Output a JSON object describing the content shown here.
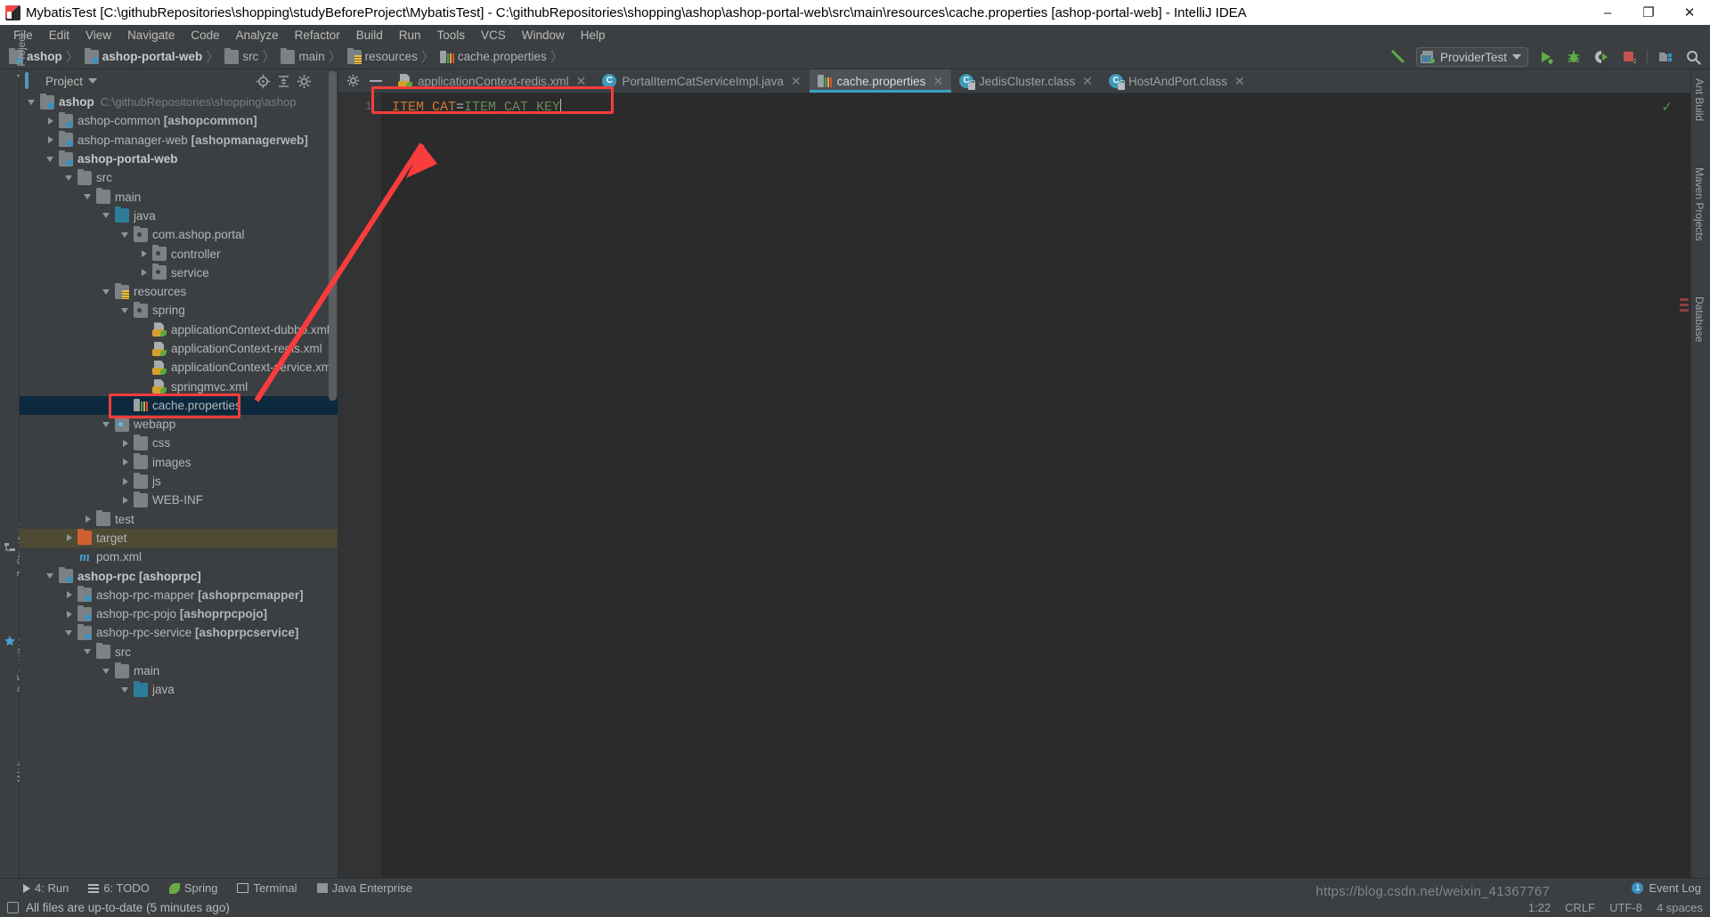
{
  "window": {
    "title": "MybatisTest [C:\\githubRepositories\\shopping\\studyBeforeProject\\MybatisTest] - C:\\githubRepositories\\shopping\\ashop\\ashop-portal-web\\src\\main\\resources\\cache.properties [ashop-portal-web] - IntelliJ IDEA",
    "minimize": "–",
    "maximize": "❐",
    "close": "✕"
  },
  "menubar": {
    "items": [
      {
        "label": "File"
      },
      {
        "label": "Edit"
      },
      {
        "label": "View"
      },
      {
        "label": "Navigate"
      },
      {
        "label": "Code"
      },
      {
        "label": "Analyze"
      },
      {
        "label": "Refactor"
      },
      {
        "label": "Build"
      },
      {
        "label": "Run"
      },
      {
        "label": "Tools"
      },
      {
        "label": "VCS"
      },
      {
        "label": "Window"
      },
      {
        "label": "Help"
      }
    ]
  },
  "navbar": {
    "crumbs": [
      {
        "label": "ashop",
        "icon": "module-icon",
        "bold": true
      },
      {
        "label": "ashop-portal-web",
        "icon": "module-icon",
        "bold": true
      },
      {
        "label": "src",
        "icon": "folder-icon",
        "bold": false
      },
      {
        "label": "main",
        "icon": "folder-icon",
        "bold": false
      },
      {
        "label": "resources",
        "icon": "resources-folder-icon",
        "bold": false
      },
      {
        "label": "cache.properties",
        "icon": "properties-file-icon",
        "bold": false
      }
    ],
    "separator": "〉",
    "run_config": "ProviderTest",
    "buttons": [
      {
        "name": "build-hammer-icon",
        "label": "Build"
      },
      {
        "name": "run-button",
        "label": "Run"
      },
      {
        "name": "debug-button",
        "label": "Debug"
      },
      {
        "name": "run-coverage-button",
        "label": "Run with Coverage"
      },
      {
        "name": "stop-button",
        "label": "Stop"
      },
      {
        "name": "project-structure-button",
        "label": "Project Structure"
      },
      {
        "name": "search-everywhere-button",
        "label": "Search Everywhere"
      }
    ]
  },
  "project_panel": {
    "title": "Project",
    "header_actions": [
      "locate-icon",
      "collapse-all-icon",
      "settings-gear-icon",
      "hide-icon"
    ],
    "tree": [
      {
        "depth": 0,
        "arrow": "down",
        "icon": "module-icon",
        "label": "ashop",
        "bold": true,
        "path": "C:\\githubRepositories\\shopping\\ashop"
      },
      {
        "depth": 1,
        "arrow": "right",
        "icon": "module-icon",
        "label": "ashop-common ",
        "module": "[ashopcommon]"
      },
      {
        "depth": 1,
        "arrow": "right",
        "icon": "module-icon",
        "label": "ashop-manager-web ",
        "module": "[ashopmanagerweb]"
      },
      {
        "depth": 1,
        "arrow": "down",
        "icon": "module-icon",
        "label": "ashop-portal-web",
        "bold": true
      },
      {
        "depth": 2,
        "arrow": "down",
        "icon": "folder-icon",
        "label": "src"
      },
      {
        "depth": 3,
        "arrow": "down",
        "icon": "folder-icon",
        "label": "main"
      },
      {
        "depth": 4,
        "arrow": "down",
        "icon": "source-root-icon",
        "label": "java"
      },
      {
        "depth": 5,
        "arrow": "down",
        "icon": "package-icon",
        "label": "com.ashop.portal"
      },
      {
        "depth": 6,
        "arrow": "right",
        "icon": "package-icon",
        "label": "controller"
      },
      {
        "depth": 6,
        "arrow": "right",
        "icon": "package-icon",
        "label": "service"
      },
      {
        "depth": 4,
        "arrow": "down",
        "icon": "resources-folder-icon",
        "label": "resources"
      },
      {
        "depth": 5,
        "arrow": "down",
        "icon": "package-icon",
        "label": "spring"
      },
      {
        "depth": 6,
        "arrow": "none",
        "icon": "spring-xml-icon",
        "label": "applicationContext-dubbo.xml"
      },
      {
        "depth": 6,
        "arrow": "none",
        "icon": "spring-xml-icon",
        "label": "applicationContext-redis.xml"
      },
      {
        "depth": 6,
        "arrow": "none",
        "icon": "spring-xml-icon",
        "label": "applicationContext-service.xml"
      },
      {
        "depth": 6,
        "arrow": "none",
        "icon": "spring-xml-icon",
        "label": "springmvc.xml"
      },
      {
        "depth": 5,
        "arrow": "none",
        "icon": "properties-file-icon",
        "label": "cache.properties",
        "selected": true
      },
      {
        "depth": 4,
        "arrow": "down",
        "icon": "webapp-folder-icon",
        "label": "webapp"
      },
      {
        "depth": 5,
        "arrow": "right",
        "icon": "folder-icon",
        "label": "css"
      },
      {
        "depth": 5,
        "arrow": "right",
        "icon": "folder-icon",
        "label": "images"
      },
      {
        "depth": 5,
        "arrow": "right",
        "icon": "folder-icon",
        "label": "js"
      },
      {
        "depth": 5,
        "arrow": "right",
        "icon": "folder-icon",
        "label": "WEB-INF"
      },
      {
        "depth": 3,
        "arrow": "right",
        "icon": "folder-icon",
        "label": "test"
      },
      {
        "depth": 2,
        "arrow": "right",
        "icon": "excluded-folder-icon",
        "label": "target",
        "excluded": true
      },
      {
        "depth": 2,
        "arrow": "none",
        "icon": "maven-icon",
        "label": "pom.xml"
      },
      {
        "depth": 1,
        "arrow": "down",
        "icon": "module-icon",
        "label": "ashop-rpc ",
        "module": "[ashoprpc]",
        "bold": true
      },
      {
        "depth": 2,
        "arrow": "right",
        "icon": "module-icon",
        "label": "ashop-rpc-mapper ",
        "module": "[ashoprpcmapper]"
      },
      {
        "depth": 2,
        "arrow": "right",
        "icon": "module-icon",
        "label": "ashop-rpc-pojo ",
        "module": "[ashoprpcpojo]"
      },
      {
        "depth": 2,
        "arrow": "down",
        "icon": "module-icon",
        "label": "ashop-rpc-service ",
        "module": "[ashoprpcservice]"
      },
      {
        "depth": 3,
        "arrow": "down",
        "icon": "folder-icon",
        "label": "src"
      },
      {
        "depth": 4,
        "arrow": "down",
        "icon": "folder-icon",
        "label": "main"
      },
      {
        "depth": 5,
        "arrow": "down",
        "icon": "source-root-icon",
        "label": "java"
      }
    ]
  },
  "editor": {
    "tabs": [
      {
        "label": "applicationContext-redis.xml",
        "icon": "spring-xml-icon",
        "active": false,
        "close": "✕"
      },
      {
        "label": "PortalItemCatServiceImpl.java",
        "icon": "class-icon",
        "active": false,
        "close": "✕"
      },
      {
        "label": "cache.properties",
        "icon": "properties-file-icon",
        "active": true,
        "close": "✕"
      },
      {
        "label": "JedisCluster.class",
        "icon": "class-locked-icon",
        "active": false,
        "close": "✕"
      },
      {
        "label": "HostAndPort.class",
        "icon": "class-locked-icon",
        "active": false,
        "close": "✕"
      }
    ],
    "line_numbers": [
      "1"
    ],
    "code": {
      "key": "ITEM_CAT",
      "equals": "=",
      "value": "ITEM_CAT_KEY"
    },
    "inspection_ok": "✓"
  },
  "left_rail": {
    "items": [
      {
        "label": "1: Project"
      },
      {
        "label": "7: Structure"
      },
      {
        "label": "2: Favorites"
      },
      {
        "label": "Web"
      }
    ]
  },
  "right_rail": {
    "items": [
      {
        "label": "Ant Build"
      },
      {
        "label": "Maven Projects"
      },
      {
        "label": "Database"
      }
    ]
  },
  "bottom_bar": {
    "items": [
      {
        "label": "4: Run",
        "icon": "run-icon"
      },
      {
        "label": "6: TODO",
        "icon": "todo-icon"
      },
      {
        "label": "Spring",
        "icon": "spring-icon"
      },
      {
        "label": "Terminal",
        "icon": "terminal-icon"
      },
      {
        "label": "Java Enterprise",
        "icon": "java-enterprise-icon"
      }
    ],
    "event_log": "Event Log",
    "event_log_count": "1"
  },
  "status_bar": {
    "message": "All files are up-to-date (5 minutes ago)",
    "position": "1:22",
    "line_sep": "CRLF",
    "encoding": "UTF-8",
    "indent": "4 spaces"
  },
  "watermark": "https://blog.csdn.net/weixin_41367767",
  "colors": {
    "accent": "#3aa0c4",
    "annotation_red": "#fa3c3c",
    "selection_blue": "#0d293e",
    "excluded_olive": "#4e4a34",
    "code_key_orange": "#cc7832",
    "code_value_green": "#6a8759"
  }
}
